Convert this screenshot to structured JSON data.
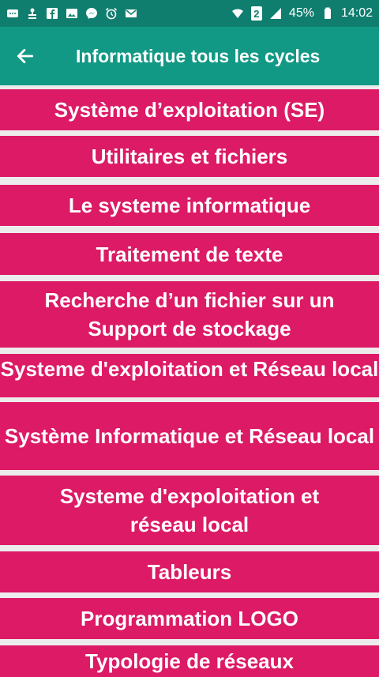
{
  "status_bar": {
    "left_icons": [
      "bbm-icon",
      "notification-icon",
      "facebook-icon",
      "gallery-icon",
      "messenger-icon",
      "alarm-icon",
      "gmail-icon"
    ],
    "sim_badge": "2",
    "battery_percent": "45%",
    "time": "14:02"
  },
  "app_bar": {
    "title": "Informatique tous les cycles"
  },
  "list": {
    "items": [
      {
        "label": "Système d’exploitation (SE)"
      },
      {
        "label": "Utilitaires et fichiers"
      },
      {
        "label": "Le systeme informatique"
      },
      {
        "label": "Traitement de texte"
      },
      {
        "label": "Recherche d’un fichier sur un Support de stockage"
      },
      {
        "label": "Systeme d'exploitation et Réseau local"
      },
      {
        "label": "Système Informatique et Réseau local"
      },
      {
        "label": "Systeme d'expoloitation et réseau local"
      },
      {
        "label": "Tableurs"
      },
      {
        "label": "Programmation LOGO"
      },
      {
        "label": "Typologie de réseaux"
      }
    ]
  }
}
